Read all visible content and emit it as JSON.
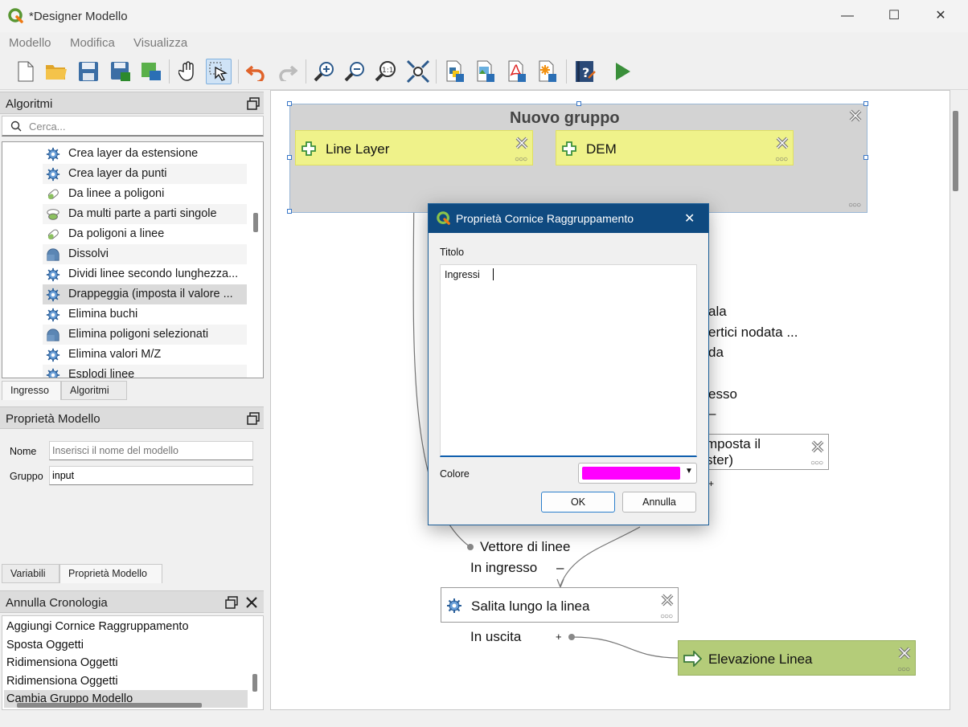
{
  "window": {
    "title": "*Designer Modello",
    "minimize": "—",
    "maximize": "☐",
    "close": "✕"
  },
  "menu": [
    "Modello",
    "Modifica",
    "Visualizza"
  ],
  "toolbar": [
    "new",
    "open",
    "save",
    "save-as",
    "export-image",
    "pan",
    "select",
    "undo",
    "redo",
    "zoom-in",
    "zoom-out",
    "zoom-actual",
    "zoom-full",
    "export-python",
    "export-image-2",
    "export-pdf",
    "export-svg",
    "help",
    "run"
  ],
  "algorithms_panel": {
    "title": "Algoritmi",
    "search_placeholder": "Cerca...",
    "items": [
      {
        "label": "Crea layer da estensione",
        "icon": "gear"
      },
      {
        "label": "Crea layer da punti",
        "icon": "gear"
      },
      {
        "label": "Da linee a poligoni",
        "icon": "line-to-poly"
      },
      {
        "label": "Da multi parte a parti singole",
        "icon": "multi"
      },
      {
        "label": "Da poligoni a linee",
        "icon": "line-to-poly"
      },
      {
        "label": "Dissolvi",
        "icon": "dissolve"
      },
      {
        "label": "Dividi linee secondo lunghezza...",
        "icon": "gear"
      },
      {
        "label": "Drappeggia (imposta il valore ...",
        "icon": "gear"
      },
      {
        "label": "Elimina buchi",
        "icon": "gear"
      },
      {
        "label": "Elimina poligoni selezionati",
        "icon": "dissolve"
      },
      {
        "label": "Elimina valori M/Z",
        "icon": "gear"
      },
      {
        "label": "Esplodi linee",
        "icon": "gear"
      }
    ],
    "selected_index": 7,
    "tabs": [
      "Ingresso",
      "Algoritmi"
    ],
    "active_tab": "Ingresso"
  },
  "model_properties": {
    "title": "Proprietà Modello",
    "name_label": "Nome",
    "name_placeholder": "Inserisci il nome del modello",
    "group_label": "Gruppo",
    "group_value": "input",
    "tabs": [
      "Variabili",
      "Proprietà Modello"
    ],
    "active_tab": "Proprietà Modello"
  },
  "history": {
    "title": "Annulla Cronologia",
    "items": [
      "Aggiungi Cornice Raggruppamento",
      "Sposta Oggetti",
      "Ridimensiona Oggetti",
      "Ridimensiona Oggetti",
      "Cambia Gruppo Modello"
    ],
    "selected_index": 4
  },
  "canvas": {
    "group_box_title": "Nuovo gruppo",
    "inputs": [
      "Line Layer",
      "DEM"
    ],
    "partial_texts": [
      "ala",
      "ertici nodata ...",
      "da",
      "esso",
      "–",
      "mposta il",
      "ster)",
      "+"
    ],
    "algo_node": {
      "param1": "Vettore di linee",
      "param2": "In ingresso",
      "param2_toggle": "–",
      "label": "Salita lungo la linea",
      "out_label": "In uscita",
      "out_toggle": "+"
    },
    "output_node": "Elevazione Linea",
    "colors": {
      "input_fill": "#eff28a",
      "output_fill": "#b4cc79",
      "group_fill": "#d3d3d3"
    }
  },
  "dialog": {
    "title": "Proprietà Cornice Raggruppamento",
    "close": "✕",
    "title_label": "Titolo",
    "title_value": "Ingressi",
    "color_label": "Colore",
    "color_value": "#ff00ff",
    "ok": "OK",
    "cancel": "Annulla"
  }
}
